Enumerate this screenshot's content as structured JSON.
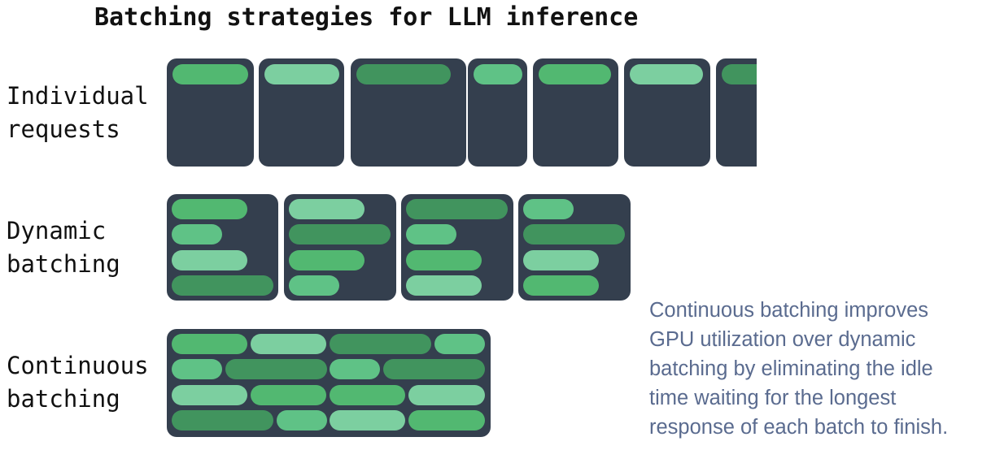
{
  "title": "Batching strategies for LLM inference",
  "colors": {
    "panel": "#343f4e",
    "bar_a": "#52b871",
    "bar_b": "#7ccfa0",
    "bar_c": "#41945e",
    "bar_d": "#5fc286",
    "caption": "#5a6b8f"
  },
  "rows": {
    "individual": {
      "label_line1": "Individual",
      "label_line2": "requests"
    },
    "dynamic": {
      "label_line1": "Dynamic",
      "label_line2": "batching"
    },
    "continuous": {
      "label_line1": "Continuous",
      "label_line2": "batching"
    }
  },
  "caption": {
    "line1": "Continuous batching improves",
    "line2": "GPU utilization over dynamic",
    "line3": "batching by eliminating the idle",
    "line4": "time waiting for the longest",
    "line5": "response of each batch to finish."
  }
}
